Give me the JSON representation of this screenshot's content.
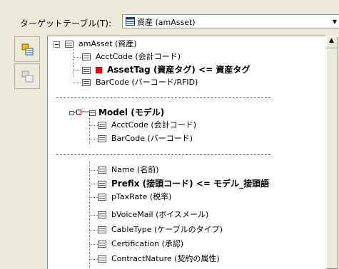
{
  "header": {
    "target_label": "ターゲットテーブル(T):",
    "target_value": "資産 (amAsset)"
  },
  "tree": {
    "root_label": "amAsset (資産)",
    "root_items": [
      {
        "label": "AcctCode (会計コード)",
        "bold": false,
        "mapped": false
      },
      {
        "label": "AssetTag (資産タグ) <= 資産タグ",
        "bold": true,
        "mapped": true
      },
      {
        "label": "BarCode (バーコード/RFID)",
        "bold": false,
        "mapped": false
      }
    ],
    "model_label": "Model (モデル)",
    "model_items": [
      {
        "label": "AcctCode (会計コード)"
      },
      {
        "label": "BarCode (バーコード)"
      }
    ],
    "model_fields": [
      {
        "label": "Name (名前)",
        "bold": false
      },
      {
        "label": "Prefix (接頭コード) <= モデル_接頭語",
        "bold": true
      },
      {
        "label": "pTaxRate (税率)",
        "bold": false
      },
      {
        "label": "bVoiceMail (ボイスメール)",
        "bold": false
      },
      {
        "label": "CableType (ケーブルのタイプ)",
        "bold": false
      },
      {
        "label": "Certification (承認)",
        "bold": false
      },
      {
        "label": "ContractNature (契約の属性)",
        "bold": false
      }
    ]
  }
}
